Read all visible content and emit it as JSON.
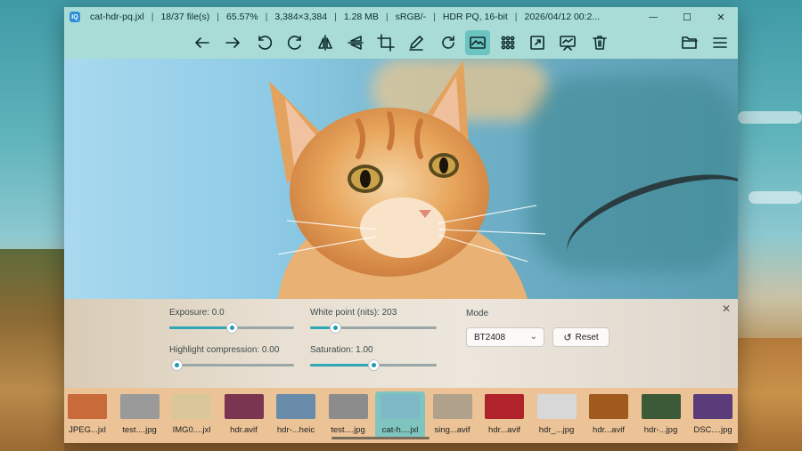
{
  "window": {
    "title_fields": [
      "cat-hdr-pq.jxl",
      "18/37 file(s)",
      "65.57%",
      "3,384×3,384",
      "1.28 MB",
      "sRGB/-",
      "HDR PQ, 16-bit",
      "2026/04/12 00:2..."
    ],
    "app_icon_text": "IQ"
  },
  "window_controls": {
    "minimize": "—",
    "maximize": "☐",
    "close": "✕"
  },
  "toolbar": {
    "buttons": [
      "back",
      "forward",
      "rotate-left",
      "rotate-right",
      "flip-horizontal",
      "flip-vertical",
      "crop",
      "edit",
      "refresh",
      "image-adjust",
      "grid-view",
      "fullscreen",
      "slideshow",
      "delete",
      "open-folder",
      "menu"
    ],
    "active": "image-adjust"
  },
  "adjust_panel": {
    "exposure_label": "Exposure: 0.0",
    "exposure_value": 0.0,
    "exposure_fraction": 0.5,
    "highlight_label": "Highlight compression: 0.00",
    "highlight_fraction": 0.0,
    "whitepoint_label": "White point (nits): 203",
    "whitepoint_fraction": 0.2,
    "saturation_label": "Saturation: 1.00",
    "saturation_fraction": 0.5,
    "mode_label": "Mode",
    "mode_value": "BT2408",
    "reset_label": "Reset",
    "close_glyph": "✕"
  },
  "filmstrip": {
    "items": [
      {
        "label": "JPEG...jxl",
        "color": "#c86a3a"
      },
      {
        "label": "test....jpg",
        "color": "#9a9a9a"
      },
      {
        "label": "IMG0....jxl",
        "color": "#d9c79a"
      },
      {
        "label": "hdr.avif",
        "color": "#7a3550"
      },
      {
        "label": "hdr-...heic",
        "color": "#6a8cab"
      },
      {
        "label": "test....jpg",
        "color": "#8c8c8c"
      },
      {
        "label": "cat-h....jxl",
        "color": "#7fb9c8"
      },
      {
        "label": "sing...avif",
        "color": "#b0a18a"
      },
      {
        "label": "hdr...avif",
        "color": "#b1232a"
      },
      {
        "label": "hdr_...jpg",
        "color": "#d8d8d8"
      },
      {
        "label": "hdr...avif",
        "color": "#a05a1e"
      },
      {
        "label": "hdr-...jpg",
        "color": "#3d5a38"
      },
      {
        "label": "DSC....jpg",
        "color": "#5a3c7a"
      }
    ],
    "active_index": 6
  }
}
